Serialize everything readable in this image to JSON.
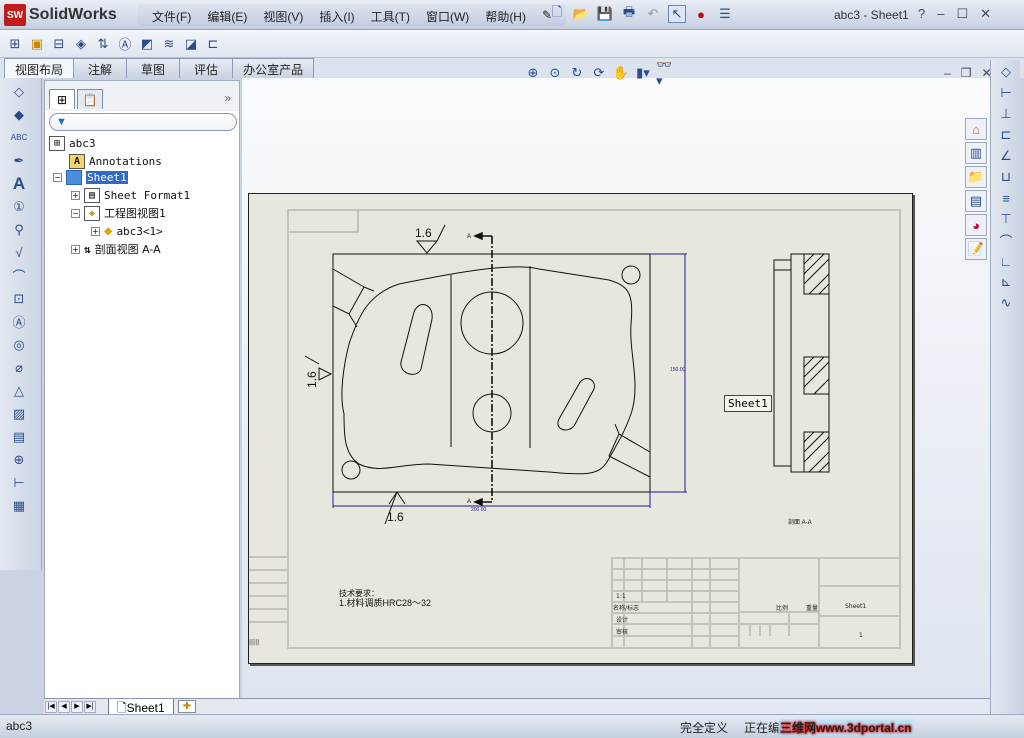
{
  "app": {
    "name": "SolidWorks",
    "logo_badge": "SW",
    "window_title": "abc3 - Sheet1"
  },
  "menu": [
    "文件(F)",
    "编辑(E)",
    "视图(V)",
    "插入(I)",
    "工具(T)",
    "窗口(W)",
    "帮助(H)"
  ],
  "command_tabs": [
    "视图布局",
    "注解",
    "草图",
    "评估",
    "办公室产品"
  ],
  "tree": {
    "root": "abc3",
    "annotations": "Annotations",
    "sheet": "Sheet1",
    "sheet_format": "Sheet Format1",
    "drawing_view": "工程图视图1",
    "part": "abc3<1>",
    "section_view": "剖面视图 A-A"
  },
  "drawing": {
    "roughness": "1.6",
    "section_label": "A",
    "dim_width": "200.00",
    "dim_height": "150.00",
    "section_caption": "剖面 A-A",
    "tech_title": "技术要求：",
    "tech_note": "1.材料调质HRC28～32",
    "title_block": {
      "sheet": "Sheet1",
      "scale": "1:1",
      "a": "比例",
      "b": "重量",
      "row1": "设计",
      "row2": "审核",
      "row3": "工艺",
      "label": "名称/标志",
      "num": "1"
    }
  },
  "tooltip": "Sheet1",
  "sheet_tab": "Sheet1",
  "status": {
    "doc": "abc3",
    "state": "完全定义",
    "editing": "正在编辑：",
    "watermark": "三维网www.3dportal.cn"
  },
  "colors": {
    "dimension": "#1a1a9c",
    "selection": "#3169c6",
    "paper": "#e8e7de"
  }
}
